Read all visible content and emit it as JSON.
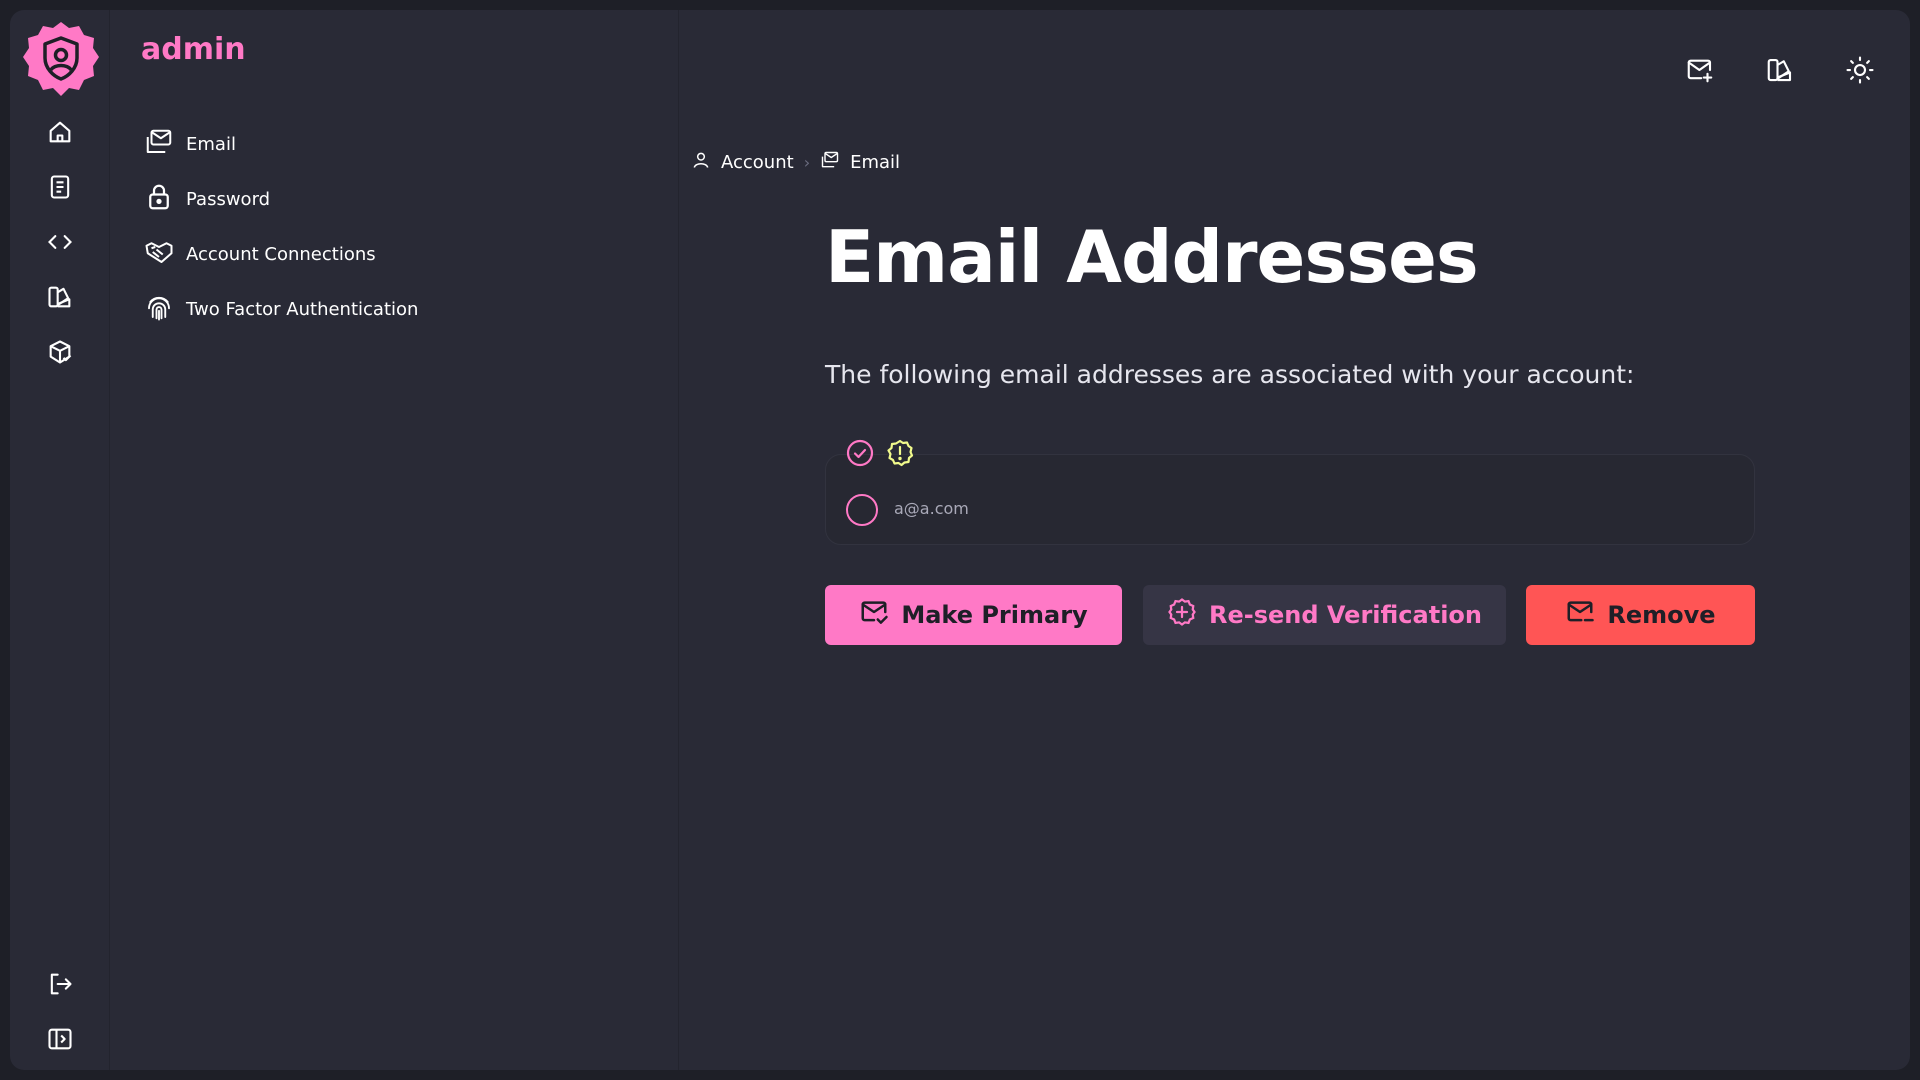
{
  "user": {
    "name": "admin"
  },
  "colors": {
    "accent": "#ff79c6",
    "danger": "#ff5555",
    "warning": "#f1fa8c",
    "background": "#292a36"
  },
  "rail": {
    "top_icons": [
      "home-icon",
      "book-icon",
      "code-icon",
      "theme-palette-icon",
      "package-icon"
    ],
    "bottom_icons": [
      "logout-icon",
      "sidebar-toggle-icon"
    ]
  },
  "subnav": {
    "items": [
      {
        "label": "Email",
        "icon": "mail-icon"
      },
      {
        "label": "Password",
        "icon": "lock-icon"
      },
      {
        "label": "Account Connections",
        "icon": "handshake-icon"
      },
      {
        "label": "Two Factor Authentication",
        "icon": "fingerprint-icon"
      }
    ]
  },
  "header": {
    "actions": [
      "mail-plus-icon",
      "palette-icon",
      "sun-icon"
    ]
  },
  "breadcrumb": [
    {
      "label": "Account",
      "icon": "user-icon"
    },
    {
      "label": "Email",
      "icon": "mail-icon"
    }
  ],
  "main": {
    "title": "Email Addresses",
    "intro": "The following email addresses are associated with your account:",
    "emails": [
      {
        "address": "a@a.com",
        "selected": false,
        "verified": true,
        "primary_warning": true
      }
    ]
  },
  "actions": {
    "make_primary": "Make Primary",
    "resend": "Re-send Verification",
    "remove": "Remove"
  }
}
